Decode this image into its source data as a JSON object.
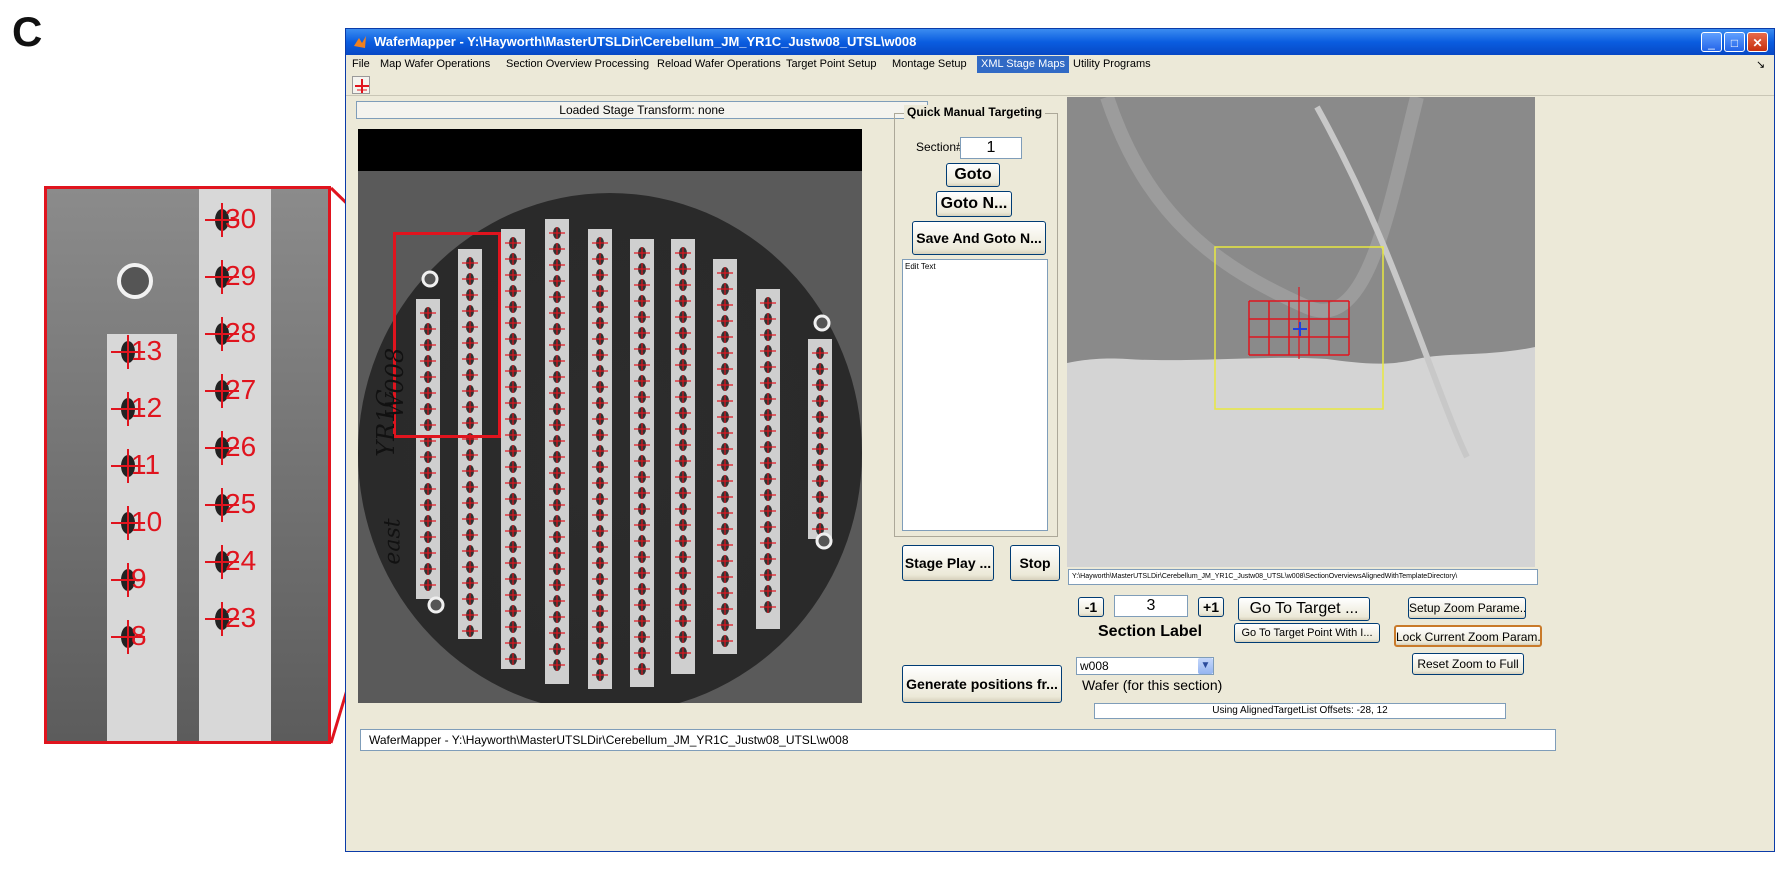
{
  "figure": {
    "panel_letter": "C"
  },
  "inset": {
    "left_strip": [
      "13",
      "12",
      "11",
      "10",
      "9",
      "8"
    ],
    "right_strip": [
      "30",
      "29",
      "28",
      "27",
      "26",
      "25",
      "24",
      "23"
    ]
  },
  "window": {
    "title": "WaferMapper - Y:\\Hayworth\\MasterUTSLDir\\Cerebellum_JM_YR1C_Justw08_UTSL\\w008",
    "controls": {
      "minimize": "_",
      "maximize": "□",
      "close": "✕"
    }
  },
  "menu": {
    "items": [
      "File",
      "Map Wafer Operations",
      "Section Overview Processing",
      "Reload Wafer Operations",
      "Target Point Setup",
      "Montage Setup",
      "XML Stage Maps",
      "Utility Programs"
    ],
    "active": "XML Stage Maps",
    "overflow_glyph": "↘"
  },
  "toolbar": {
    "crosshair_icon": "crosshair-icon"
  },
  "stage_transform": {
    "text": "Loaded Stage Transform: none"
  },
  "quick_targeting": {
    "title": "Quick Manual Targeting",
    "section_label": "Section#",
    "section_value": "1",
    "goto": "Goto",
    "goto_n": "Goto N...",
    "save_goto": "Save And Goto N...",
    "edit_text": "Edit Text",
    "stage_play": "Stage Play ...",
    "stop": "Stop",
    "generate": "Generate positions fr..."
  },
  "overview_path": "Y:\\Hayworth\\MasterUTSLDir\\Cerebellum_JM_YR1C_Justw08_UTSL\\w008\\SectionOverviewsAlignedWithTemplateDirectory\\",
  "section_nav": {
    "minus": "-1",
    "value": "3",
    "plus": "+1",
    "label": "Section Label"
  },
  "targets": {
    "go_to_target": "Go To Target ...",
    "go_to_target_point": "Go To Target Point With I..."
  },
  "zoom": {
    "setup": "Setup Zoom Parame...",
    "lock": "Lock Current Zoom Param...",
    "reset": "Reset Zoom to Full"
  },
  "wafer_select": {
    "value": "w008",
    "label": "Wafer (for this section)"
  },
  "offsets": {
    "text": "Using AlignedTargetList Offsets: -28, 12"
  },
  "status": {
    "text": "WaferMapper - Y:\\Hayworth\\MasterUTSLDir\\Cerebellum_JM_YR1C_Justw08_UTSL\\w008"
  },
  "wafer_annotation": [
    "YR1C",
    "W008",
    "east"
  ],
  "colors": {
    "accent": "#316ac5",
    "marker": "#e0141e",
    "target_box": "#e8e840"
  }
}
